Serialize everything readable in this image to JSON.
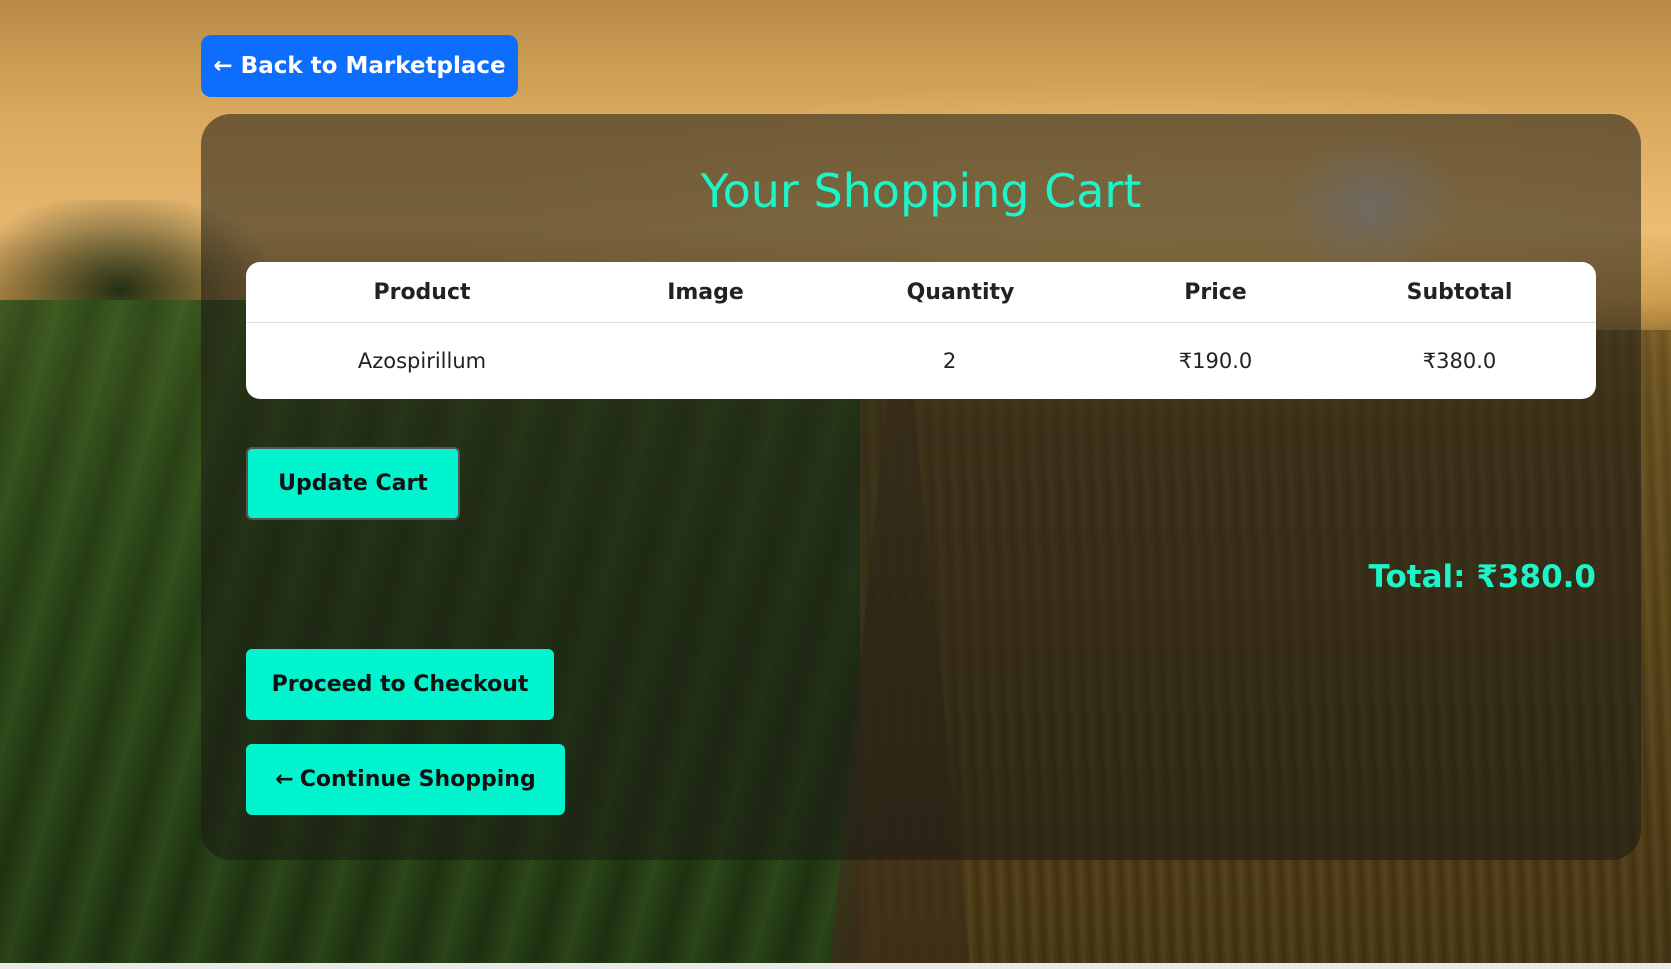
{
  "nav": {
    "back_label": "Back to Marketplace",
    "back_arrow": "←"
  },
  "cart": {
    "title": "Your Shopping Cart",
    "columns": [
      "Product",
      "Image",
      "Quantity",
      "Price",
      "Subtotal"
    ],
    "rows": [
      {
        "product": "Azospirillum",
        "image": "",
        "quantity": "2",
        "price": "₹190.0",
        "subtotal": "₹380.0"
      }
    ],
    "update_label": "Update Cart",
    "total_label": "Total: ₹380.0",
    "checkout_label": "Proceed to Checkout",
    "continue_label": "Continue Shopping",
    "continue_arrow": "←"
  },
  "colors": {
    "accent": "#1cf5c9",
    "button_teal": "#00f5cf",
    "primary_blue": "#0d6efd"
  },
  "icons": {
    "back": "left-arrow-icon",
    "continue": "left-arrow-icon"
  }
}
